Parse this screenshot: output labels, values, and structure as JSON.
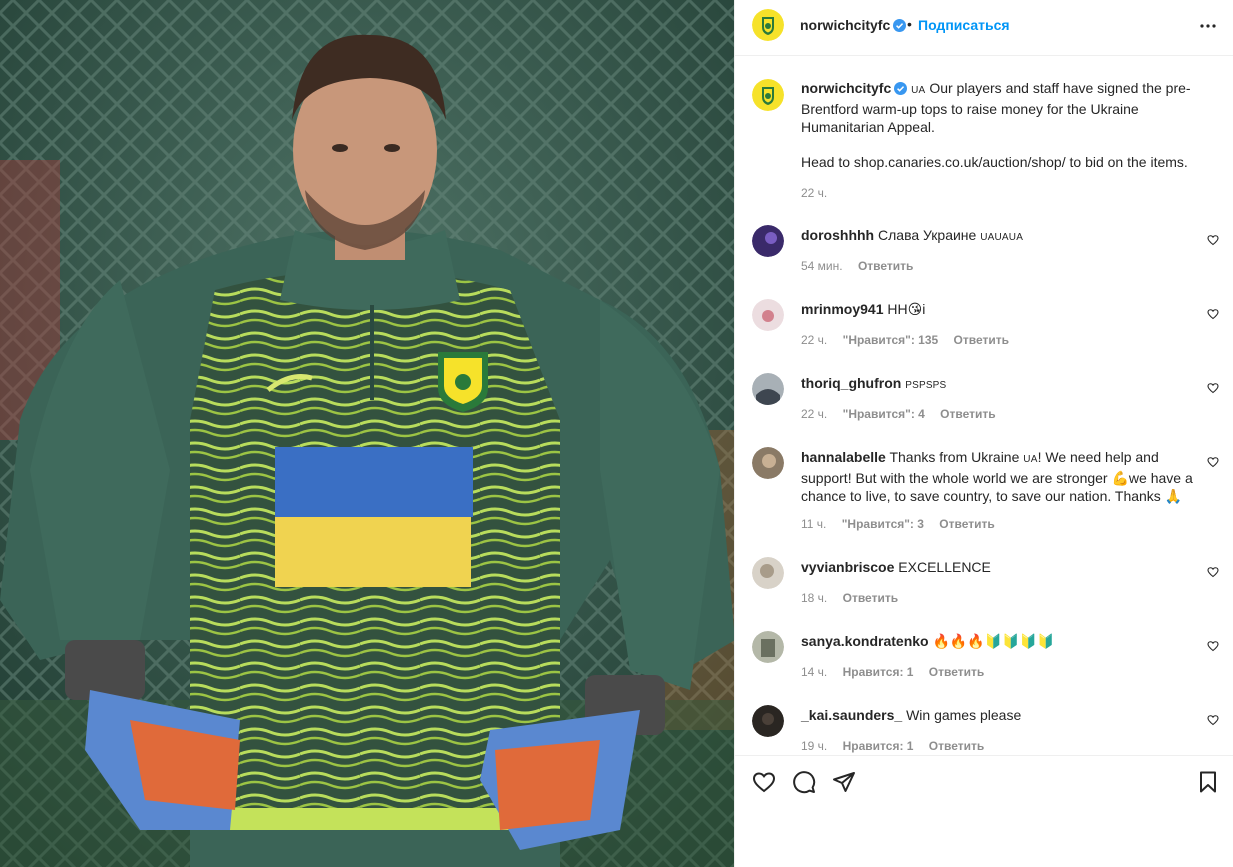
{
  "post": {
    "username": "norwichcityfc",
    "separator": "•",
    "follow_label": "Подписаться",
    "caption": {
      "username": "norwichcityfc",
      "flag": "UA",
      "text": "Our players and staff have signed the pre-Brentford warm-up tops to raise money for the Ukraine Humanitarian Appeal.",
      "text2": "Head to shop.canaries.co.uk/auction/shop/ to bid on the items.",
      "time": "22 ч."
    }
  },
  "comments": [
    {
      "username": "doroshhhh",
      "text": "Слава Украине",
      "suffix": "UAUAUA",
      "time": "54 мин.",
      "likes": "",
      "reply": "Ответить",
      "avatar_color": "#3a2a6a"
    },
    {
      "username": "mrinmoy941",
      "text": "HH😘i",
      "suffix": "",
      "time": "22 ч.",
      "likes": "\"Нравится\": 135",
      "reply": "Ответить",
      "avatar_color": "#e8d0d4"
    },
    {
      "username": "thoriq_ghufron",
      "text": "",
      "suffix": "PSPSPS",
      "time": "22 ч.",
      "likes": "\"Нравится\": 4",
      "reply": "Ответить",
      "avatar_color": "#5a6470"
    },
    {
      "username": "hannalabelle",
      "text": "Thanks from Ukraine",
      "suffix": "UA",
      "text_after": "! We need help and support! But with the whole world we are stronger 💪we have a chance to live, to save country, to save our nation. Thanks 🙏",
      "time": "11 ч.",
      "likes": "\"Нравится\": 3",
      "reply": "Ответить",
      "avatar_color": "#7a6a58"
    },
    {
      "username": "vyvianbriscoe",
      "text": "EXCELLENCE",
      "suffix": "",
      "time": "18 ч.",
      "likes": "",
      "reply": "Ответить",
      "avatar_color": "#c8c2b8"
    },
    {
      "username": "sanya.kondratenko",
      "text": "🔥🔥🔥🔰🔰🔰🔰",
      "suffix": "",
      "time": "14 ч.",
      "likes": "Нравится: 1",
      "reply": "Ответить",
      "avatar_color": "#9aa090"
    },
    {
      "username": "_kai.saunders_",
      "text": "Win games please",
      "suffix": "",
      "time": "19 ч.",
      "likes": "Нравится: 1",
      "reply": "Ответить",
      "avatar_color": "#2a2622"
    }
  ],
  "actions": {
    "like_icon": "heart-icon",
    "comment_icon": "comment-bubble-icon",
    "share_icon": "paper-plane-icon",
    "save_icon": "bookmark-icon"
  },
  "colors": {
    "link_blue": "#0095f6",
    "verified_blue": "#3897f0",
    "text_primary": "#262626",
    "text_secondary": "#8e8e8e",
    "ukraine_blue": "#3a6fc4",
    "ukraine_yellow": "#f0d350",
    "norwich_yellow": "#f6e22a",
    "norwich_green": "#2a7a3a"
  }
}
